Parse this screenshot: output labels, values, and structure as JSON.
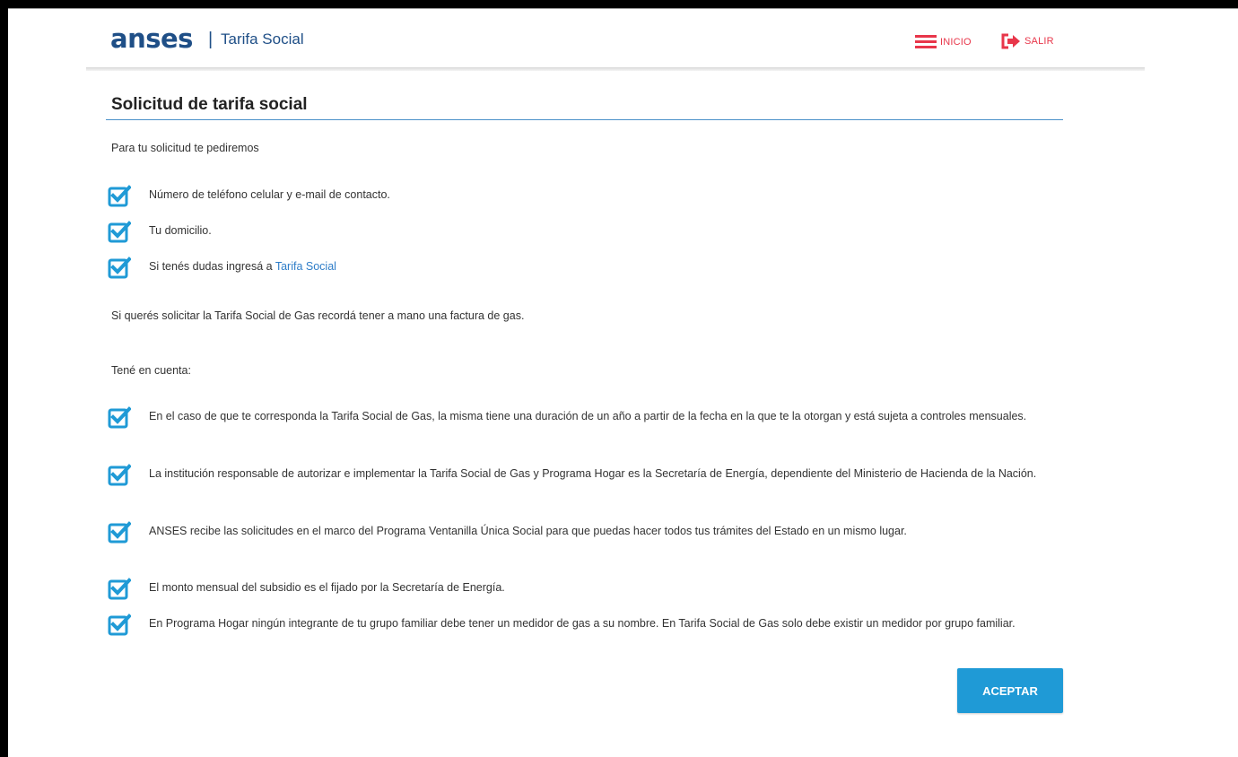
{
  "header": {
    "logo": "anses",
    "separator": "|",
    "subtitle": "Tarifa Social",
    "nav_inicio": "INICIO",
    "nav_salir": "SALIR"
  },
  "main": {
    "title": "Solicitud de tarifa social",
    "intro": "Para tu solicitud te pediremos",
    "requirements": [
      "Número de teléfono celular y e-mail de contacto.",
      "Tu domicilio.",
      "Si tenés dudas ingresá a"
    ],
    "requirements_link": "Tarifa Social",
    "gas_note": "Si querés solicitar la Tarifa Social de Gas recordá tener a mano una factura de gas.",
    "consider_heading": "Tené en cuenta:",
    "considerations": [
      "En el caso de que te corresponda la Tarifa Social de Gas, la misma tiene una duración de un año a partir de la fecha en la que te la otorgan y está sujeta a controles mensuales.",
      "La institución responsable de autorizar e implementar la Tarifa Social de Gas y Programa Hogar es la Secretaría de Energía, dependiente del Ministerio de Hacienda de la Nación.",
      "ANSES recibe las solicitudes en el marco del Programa Ventanilla Única Social para que puedas hacer todos tus trámites del Estado en un mismo lugar.",
      "El monto mensual del subsidio es el fijado por la Secretaría de Energía.",
      "En Programa Hogar ningún integrante de tu grupo familiar debe tener un medidor de gas a su nombre. En Tarifa Social de Gas solo debe existir un medidor por grupo familiar."
    ],
    "accept_label": "ACEPTAR"
  },
  "colors": {
    "brand_blue": "#1f4f87",
    "accent_red": "#e8364a",
    "check_blue": "#1f9ad6",
    "button_blue": "#1f9ad6",
    "link_blue": "#2e7dc8"
  },
  "icons": {
    "menu": "hamburger-menu-icon",
    "exit": "exit-arrow-icon",
    "check": "checkbox-checked-icon"
  }
}
